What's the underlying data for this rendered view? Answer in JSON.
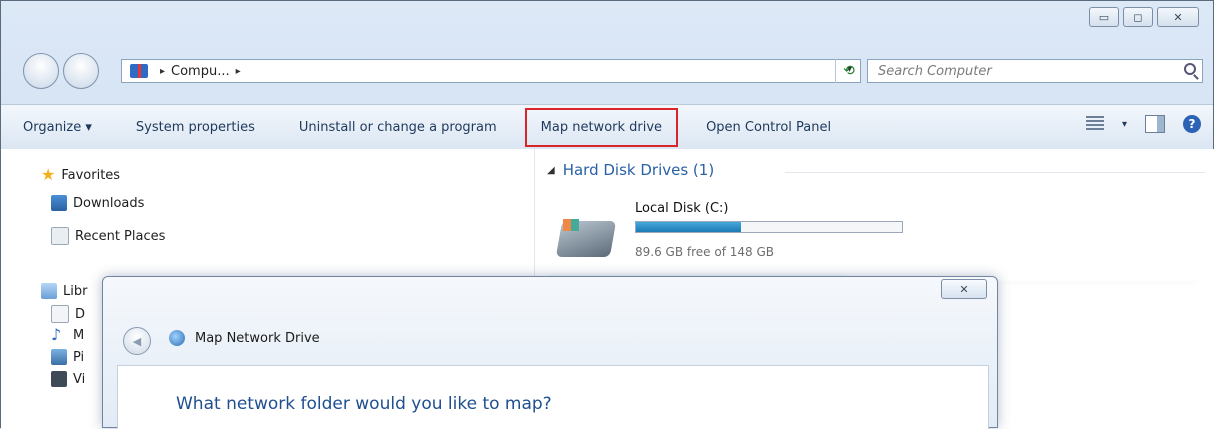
{
  "window": {
    "caption_buttons": {
      "minimize": "▭",
      "maximize": "◻",
      "close": "✕"
    }
  },
  "address_bar": {
    "breadcrumb_label": "Compu...",
    "refresh_icon": "refresh-arrows-icon",
    "search_placeholder": "Search Computer"
  },
  "toolbar": {
    "items": [
      {
        "label": "Organize ▾"
      },
      {
        "label": "System properties"
      },
      {
        "label": "Uninstall or change a program"
      },
      {
        "label": "Map network drive",
        "highlighted": true
      },
      {
        "label": "Open Control Panel"
      }
    ],
    "highlight_color": "#d9252a"
  },
  "nav_pane": {
    "favorites": {
      "label": "Favorites",
      "items": [
        {
          "label": "Downloads"
        },
        {
          "label": "Recent Places"
        }
      ]
    },
    "libraries_partial": {
      "label": "Libr",
      "items": [
        "D",
        "M",
        "Pi",
        "Vi"
      ]
    }
  },
  "main": {
    "group_title": "Hard Disk Drives (1)",
    "drive": {
      "name": "Local Disk (C:)",
      "free_text": "89.6 GB free of 148 GB",
      "used_fraction": 0.395
    }
  },
  "dialog": {
    "title": "Map Network Drive",
    "close_glyph": "✕",
    "question": "What network folder would you like to map?"
  },
  "colors": {
    "accent": "#2a61a5",
    "drive_bar": "#1b7ab5"
  }
}
